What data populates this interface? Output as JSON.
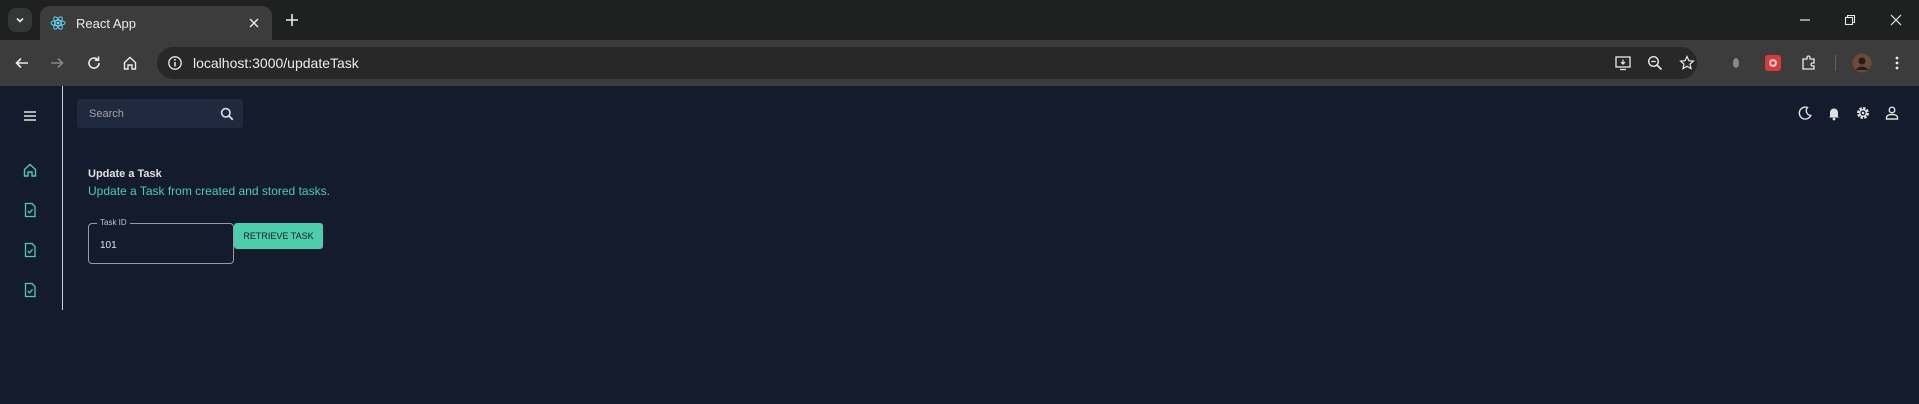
{
  "browser": {
    "tab_title": "React App",
    "url": "localhost:3000/updateTask"
  },
  "app": {
    "search": {
      "placeholder": "Search"
    },
    "sidebar": {
      "items": [
        {
          "icon": "home-icon"
        },
        {
          "icon": "task-check-icon"
        },
        {
          "icon": "task-check-icon"
        },
        {
          "icon": "task-check-icon"
        }
      ]
    },
    "topbar_icons": [
      "dark-mode-icon",
      "notifications-icon",
      "settings-icon",
      "person-icon"
    ],
    "page": {
      "title": "Update a Task",
      "subtitle": "Update a Task from created and stored tasks."
    },
    "form": {
      "task_id_label": "Task ID",
      "task_id_value": "101",
      "retrieve_button": "RETRIEVE TASK"
    }
  },
  "colors": {
    "background": "#141b2d",
    "accent": "#4cceac",
    "search_bg": "#1f2a40"
  }
}
